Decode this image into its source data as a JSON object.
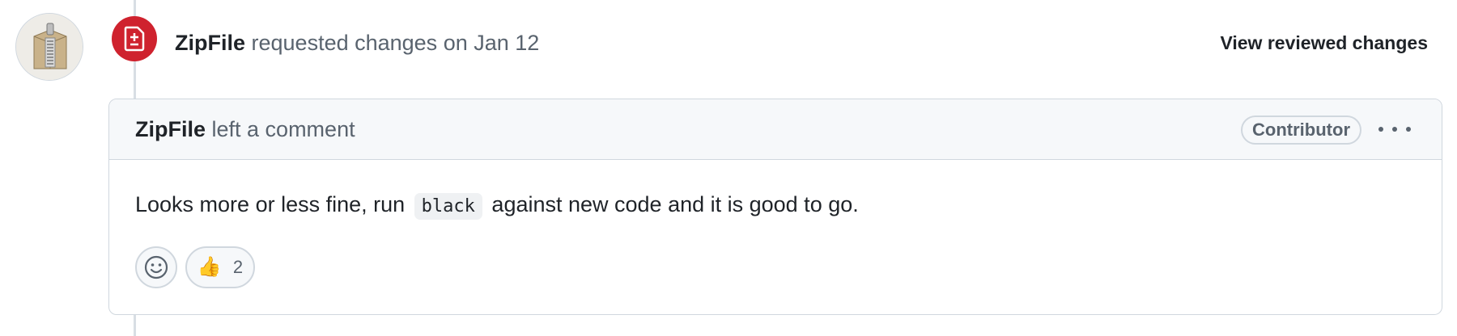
{
  "event": {
    "author": "ZipFile",
    "action_text": "requested changes on Jan 12",
    "view_link_label": "View reviewed changes"
  },
  "comment": {
    "author": "ZipFile",
    "header_suffix": "left a comment",
    "role_badge": "Contributor",
    "body_before": "Looks more or less fine, run",
    "body_code": "black",
    "body_after": "against new code and it is good to go.",
    "reactions": [
      {
        "emoji": "👍",
        "count": "2"
      }
    ]
  },
  "colors": {
    "changes_requested_badge": "#cf222e",
    "header_bg": "#f6f8fa",
    "border": "#d0d7de"
  },
  "icons": {
    "avatar": "zip-file-avatar",
    "badge": "file-diff-icon",
    "add_reaction": "smiley-icon",
    "more": "kebab-horizontal-icon"
  }
}
